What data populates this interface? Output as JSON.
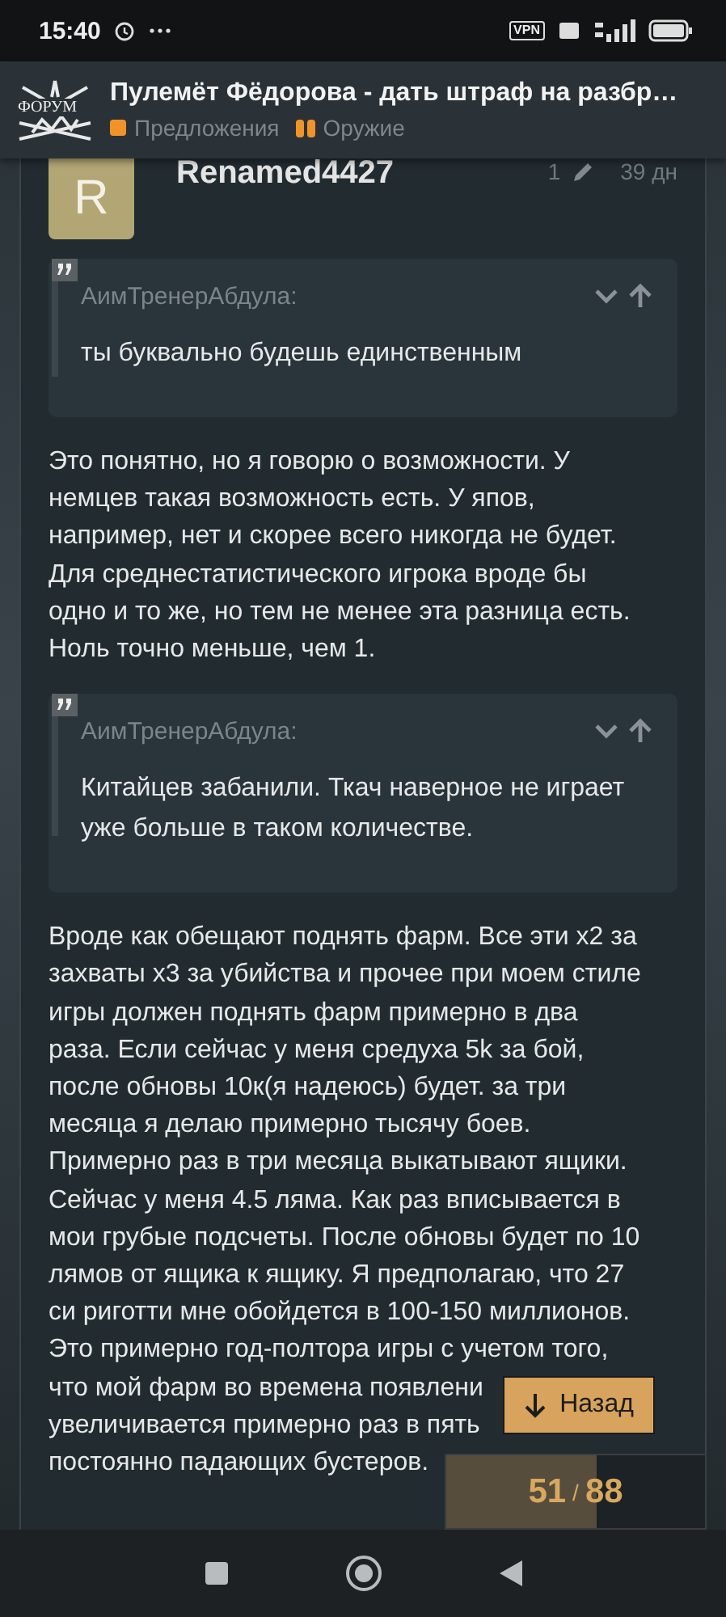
{
  "status_bar": {
    "time": "15:40",
    "vpn": "VPN"
  },
  "header": {
    "logo": "ФОРУМ",
    "title": "Пулемёт Фёдорова - дать штраф на разбр…",
    "categories": [
      {
        "name": "Предложения",
        "color": "#f0932b",
        "kind": "single"
      },
      {
        "name": "Оружие",
        "color": "#f0932b",
        "kind": "split"
      }
    ]
  },
  "post": {
    "avatar_letter": "R",
    "username": "Renamed4427",
    "edits": "1",
    "age": "39 дн",
    "blocks": [
      {
        "kind": "quote",
        "author": "АимТренерАбдула:",
        "lines": [
          "ты буквально будешь единственным"
        ]
      },
      {
        "kind": "text",
        "lines": [
          "Это понятно, но я говорю о возможности. У",
          "немцев такая возможность есть. У япов,",
          "например, нет и скорее всего никогда не будет.",
          "Для среднестатистического игрока вроде бы",
          "одно и то же, но тем не менее эта разница есть.",
          "Ноль точно меньше, чем 1."
        ]
      },
      {
        "kind": "quote",
        "author": "АимТренерАбдула:",
        "lines": [
          "Китайцев забанили. Ткач наверное не играет",
          "уже больше в таком количестве."
        ]
      },
      {
        "kind": "text",
        "lines": [
          "Вроде как обещают поднять фарм. Все эти x2 за",
          "захваты x3 за убийства и прочее при моем стиле",
          "игры должен поднять фарм примерно в два",
          "раза. Если сейчас у меня средуха 5k за бой,",
          "после обновы 10к(я надеюсь) будет. за три",
          "месяца я делаю примерно тысячу боев.",
          "Примерно раз в три месяца выкатывают ящики.",
          "Сейчас у меня 4.5 ляма. Как раз вписывается в",
          "мои грубые подсчеты. После обновы будет по 10",
          "лямов от ящика к ящику. Я предполагаю, что 27",
          "си риготти мне обойдется в 100-150 миллионов.",
          "Это примерно год-полтора игры с учетом того,",
          "что мой фарм во времена появлени",
          "увеличивается примерно раз в пять",
          "постоянно падающих бустеров."
        ]
      }
    ]
  },
  "back_button": {
    "label": "Назад"
  },
  "progress": {
    "current": "51",
    "separator": "/",
    "total": "88",
    "level": 0.58
  }
}
